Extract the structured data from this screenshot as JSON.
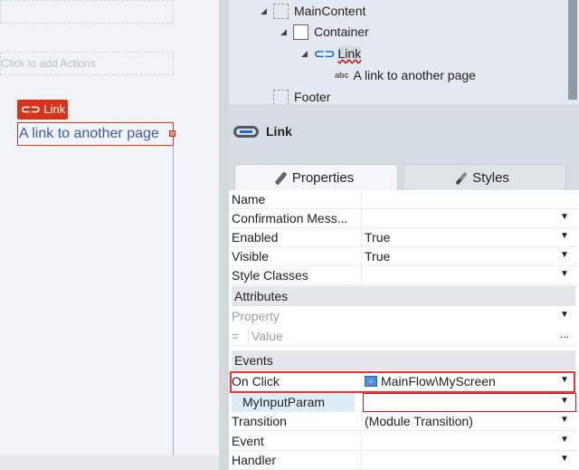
{
  "canvas": {
    "actions_placeholder": "Click to add Actions",
    "widget_badge": "Link",
    "link_text": "A link to another page"
  },
  "tree": {
    "items": [
      {
        "label": "MainContent"
      },
      {
        "label": "Container"
      },
      {
        "label": "Link"
      },
      {
        "label": "A link to another page",
        "icon_text": "abc"
      },
      {
        "label": "Footer"
      }
    ]
  },
  "props": {
    "title": "Link",
    "tabs": [
      "Properties",
      "Styles"
    ],
    "rows": [
      {
        "label": "Name",
        "value": ""
      },
      {
        "label": "Confirmation Mess...",
        "value": ""
      },
      {
        "label": "Enabled",
        "value": "True"
      },
      {
        "label": "Visible",
        "value": "True"
      },
      {
        "label": "Style Classes",
        "value": ""
      }
    ],
    "attributes": {
      "header": "Attributes",
      "property_placeholder": "Property",
      "eq": "=",
      "value_placeholder": "Value",
      "ellipsis": "..."
    },
    "events": {
      "header": "Events",
      "rows": [
        {
          "label": "On Click",
          "value": "MainFlow\\MyScreen"
        },
        {
          "label": "MyInputParam",
          "value": ""
        },
        {
          "label": "Transition",
          "value": "(Module Transition)"
        },
        {
          "label": "Event",
          "value": ""
        },
        {
          "label": "Handler",
          "value": ""
        }
      ]
    },
    "arrow": "▼"
  }
}
